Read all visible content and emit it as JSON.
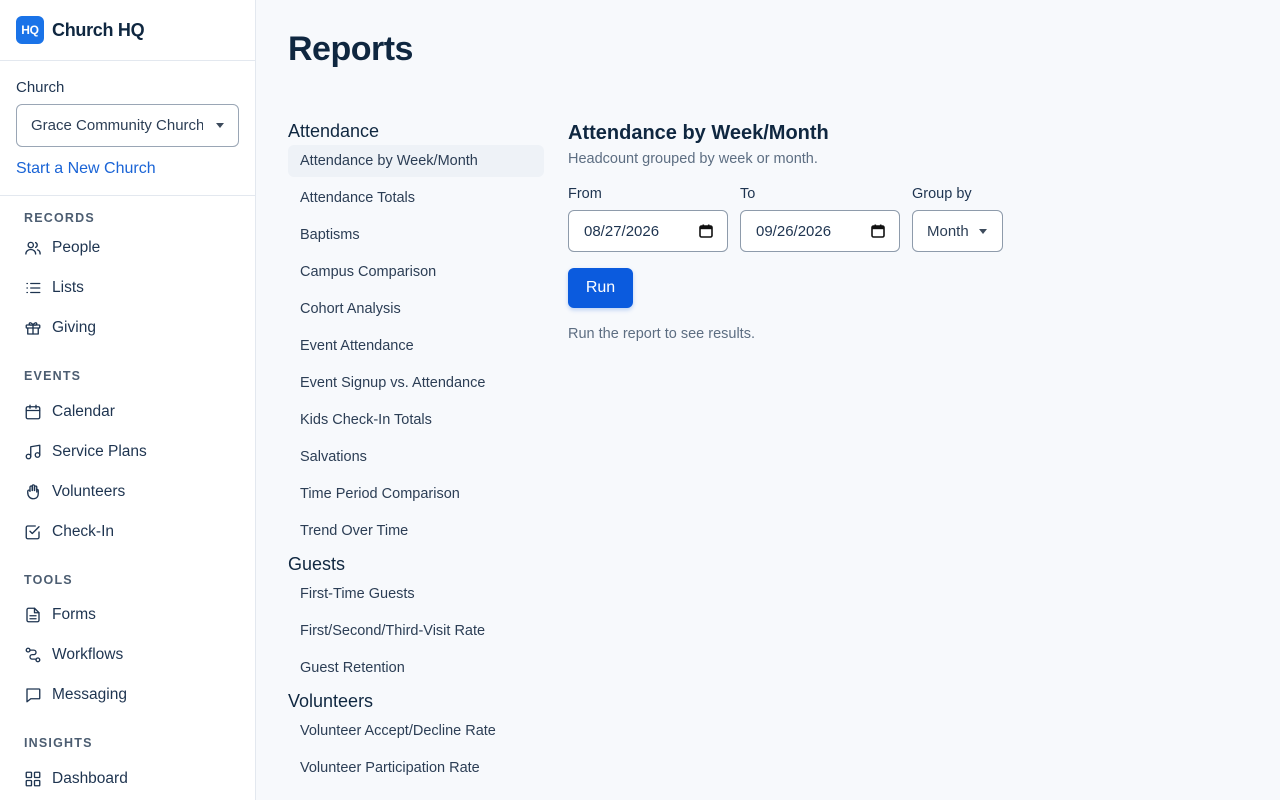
{
  "brand": {
    "logo_text": "HQ",
    "name": "Church HQ",
    "accent": "#1a73e8"
  },
  "church": {
    "label": "Church",
    "selected": "Grace Community Church",
    "new_link": "Start a New Church"
  },
  "nav": {
    "records": {
      "heading": "RECORDS",
      "items": [
        "People",
        "Lists",
        "Giving"
      ]
    },
    "events": {
      "heading": "EVENTS",
      "items": [
        "Calendar",
        "Service Plans",
        "Volunteers",
        "Check-In"
      ]
    },
    "tools": {
      "heading": "TOOLS",
      "items": [
        "Forms",
        "Workflows",
        "Messaging"
      ]
    },
    "insights": {
      "heading": "INSIGHTS",
      "items": [
        "Dashboard"
      ]
    }
  },
  "page": {
    "title": "Reports"
  },
  "reports": {
    "attendance": {
      "title": "Attendance",
      "items": [
        "Attendance by Week/Month",
        "Attendance Totals",
        "Baptisms",
        "Campus Comparison",
        "Cohort Analysis",
        "Event Attendance",
        "Event Signup vs. Attendance",
        "Kids Check-In Totals",
        "Salvations",
        "Time Period Comparison",
        "Trend Over Time"
      ]
    },
    "guests": {
      "title": "Guests",
      "items": [
        "First-Time Guests",
        "First/Second/Third-Visit Rate",
        "Guest Retention"
      ]
    },
    "volunteers": {
      "title": "Volunteers",
      "items": [
        "Volunteer Accept/Decline Rate",
        "Volunteer Participation Rate"
      ]
    }
  },
  "panel": {
    "title": "Attendance by Week/Month",
    "subtitle": "Headcount grouped by week or month.",
    "from_label": "From",
    "from_value": "08/27/2026",
    "to_label": "To",
    "to_value": "09/26/2026",
    "group_label": "Group by",
    "group_value": "Month",
    "run_label": "Run",
    "hint": "Run the report to see results."
  }
}
